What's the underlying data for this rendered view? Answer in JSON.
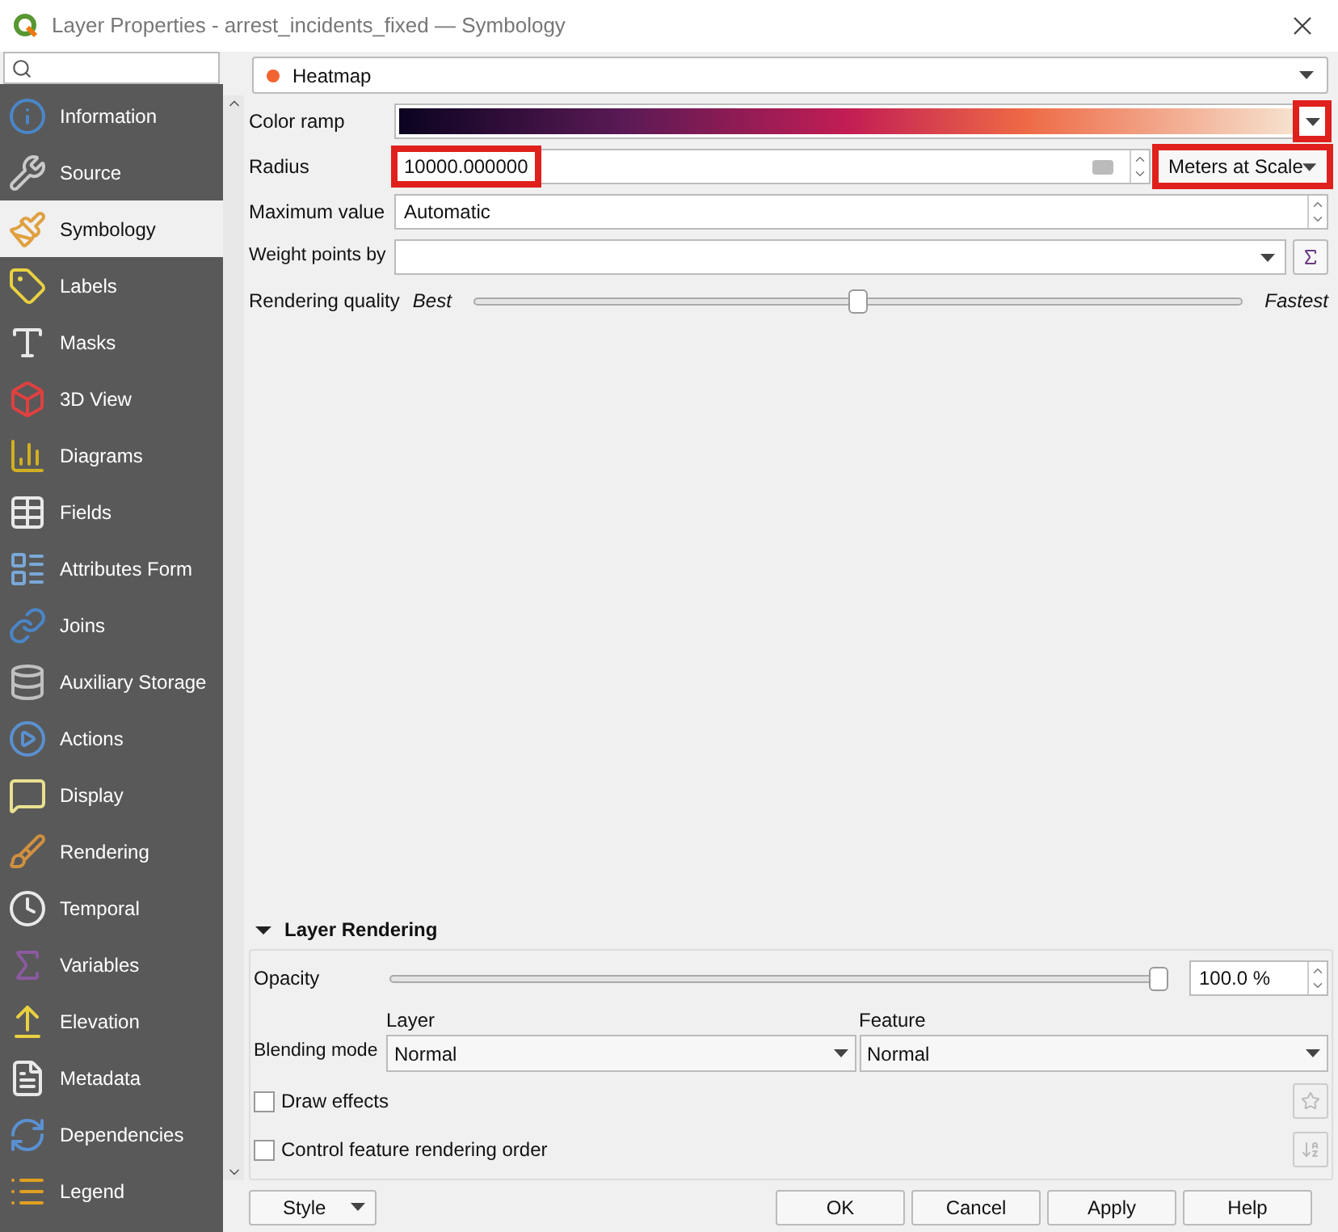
{
  "window": {
    "title": "Layer Properties - arrest_incidents_fixed — Symbology"
  },
  "sidebar": {
    "items": [
      {
        "label": "Information",
        "selected": false
      },
      {
        "label": "Source",
        "selected": false
      },
      {
        "label": "Symbology",
        "selected": true
      },
      {
        "label": "Labels",
        "selected": false
      },
      {
        "label": "Masks",
        "selected": false
      },
      {
        "label": "3D View",
        "selected": false
      },
      {
        "label": "Diagrams",
        "selected": false
      },
      {
        "label": "Fields",
        "selected": false
      },
      {
        "label": "Attributes Form",
        "selected": false
      },
      {
        "label": "Joins",
        "selected": false
      },
      {
        "label": "Auxiliary Storage",
        "selected": false
      },
      {
        "label": "Actions",
        "selected": false
      },
      {
        "label": "Display",
        "selected": false
      },
      {
        "label": "Rendering",
        "selected": false
      },
      {
        "label": "Temporal",
        "selected": false
      },
      {
        "label": "Variables",
        "selected": false
      },
      {
        "label": "Elevation",
        "selected": false
      },
      {
        "label": "Metadata",
        "selected": false
      },
      {
        "label": "Dependencies",
        "selected": false
      },
      {
        "label": "Legend",
        "selected": false
      }
    ]
  },
  "renderer": {
    "value": "Heatmap"
  },
  "form": {
    "color_ramp": {
      "label": "Color ramp",
      "highlighted": true
    },
    "radius": {
      "label": "Radius",
      "value": "10000.000000",
      "highlighted": true,
      "unit": "Meters at Scale",
      "unit_highlighted": true
    },
    "maximum_value": {
      "label": "Maximum value",
      "value": "Automatic"
    },
    "weight_points_by": {
      "label": "Weight points by"
    },
    "rendering_quality": {
      "label": "Rendering quality",
      "min_label": "Best",
      "max_label": "Fastest",
      "level": 0.5
    }
  },
  "layer_rendering": {
    "title": "Layer Rendering",
    "expanded": true,
    "opacity": {
      "label": "Opacity",
      "level": 1.0,
      "value": "100.0 %"
    },
    "blending_mode": {
      "label": "Blending mode",
      "layer_label": "Layer",
      "layer_value": "Normal",
      "feature_label": "Feature",
      "feature_value": "Normal"
    },
    "checkboxes": [
      {
        "label": "Draw effects",
        "checked": false
      },
      {
        "label": "Control feature rendering order",
        "checked": false
      }
    ]
  },
  "buttons": {
    "style": "Style",
    "actions": [
      "OK",
      "Cancel",
      "Apply",
      "Help"
    ]
  }
}
